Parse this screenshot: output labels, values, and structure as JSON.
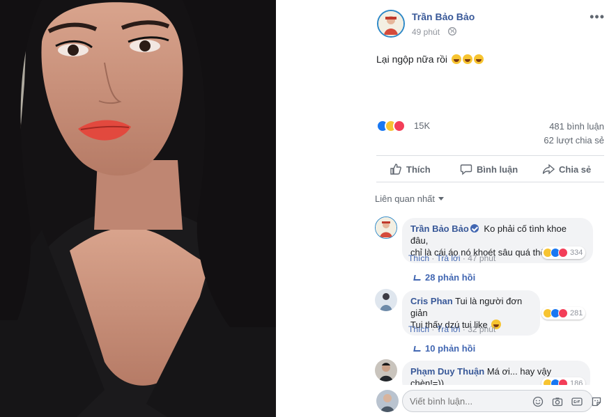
{
  "post": {
    "author": "Trần Bảo Bảo",
    "time": "49 phút",
    "text": "Lại ngộp nữa rồi",
    "reactions_count": "15K",
    "comments_count": "481 bình luận",
    "shares_count": "62 lượt chia sẻ"
  },
  "actions": {
    "like": "Thích",
    "comment": "Bình luận",
    "share": "Chia sẻ"
  },
  "sort_label": "Liên quan nhất",
  "comments": [
    {
      "author": "Trần Bảo Bảo",
      "line1": "Ko phải cố tình khoe đâu,",
      "line2": "chỉ là cái áo nó khoét sâu quá thôi",
      "like": "Thích",
      "reply": "Trả lời",
      "time": "47 phút",
      "reaction_count": "334",
      "replies": "28 phản hồi"
    },
    {
      "author": "Cris Phan",
      "line1": "Tui là người đơn giản",
      "line2": "Tui thấy dzú tui like",
      "like": "Thích",
      "reply": "Trả lời",
      "time": "32 phút",
      "reaction_count": "281",
      "replies": "10 phản hồi"
    },
    {
      "author": "Phạm Duy Thuận",
      "line1": "Má ơi... hay vậy chèn!=))",
      "reaction_count": "186"
    }
  ],
  "composer": {
    "placeholder": "Viết bình luận..."
  },
  "colors": {
    "brand_link": "#385898",
    "action_blue": "#4267b2",
    "like_blue": "#1877f2",
    "haha_yellow": "#f7c431",
    "love_red": "#f33e58",
    "muted_text": "#90949c"
  },
  "icons": [
    "globe-icon",
    "more-options-icon",
    "thumbs-up-icon",
    "speech-bubble-icon",
    "share-arrow-icon",
    "caret-down-icon",
    "verified-badge-icon",
    "reply-arrow-icon",
    "emoji-icon",
    "camera-icon",
    "gif-icon",
    "sticker-icon"
  ]
}
